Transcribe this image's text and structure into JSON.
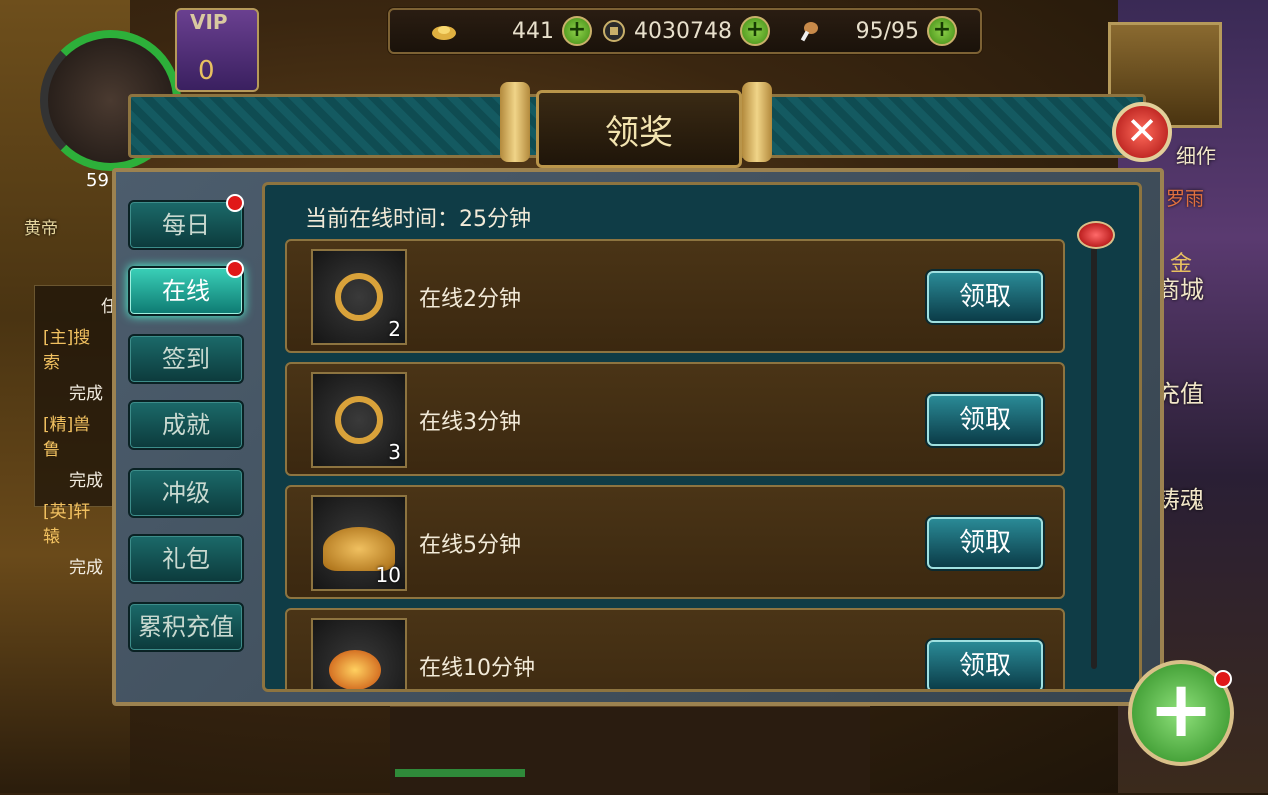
{
  "hud": {
    "vip_label": "VIP",
    "vip_level": "0",
    "player_level": "59",
    "resources": [
      {
        "icon": "gold-ingot-icon",
        "value": "441"
      },
      {
        "icon": "copper-coin-icon",
        "value": "4030748"
      },
      {
        "icon": "drumstick-icon",
        "value": "95/95"
      }
    ],
    "add_symbol": "+"
  },
  "side": {
    "left_name": "黄帝",
    "right_top": "细作",
    "right_name": "罗雨",
    "shop_gold": "金",
    "shop": "商城",
    "recharge": "充值",
    "forge": "铸魂"
  },
  "quests": [
    {
      "tag": "[主]搜索",
      "status": "完成"
    },
    {
      "tag": "[精]兽鲁",
      "status": "完成"
    },
    {
      "tag": "[英]轩辕",
      "status": "完成"
    }
  ],
  "quest_title": "任",
  "dialog": {
    "title": "领奖",
    "close_symbol": "✕",
    "online_time": "当前在线时间：25分钟",
    "tabs": [
      {
        "label": "每日",
        "active": false,
        "dot": true
      },
      {
        "label": "在线",
        "active": true,
        "dot": true
      },
      {
        "label": "签到",
        "active": false,
        "dot": false
      },
      {
        "label": "成就",
        "active": false,
        "dot": false
      },
      {
        "label": "冲级",
        "active": false,
        "dot": false
      },
      {
        "label": "礼包",
        "active": false,
        "dot": false
      },
      {
        "label": "累积充值",
        "active": false,
        "dot": false
      }
    ],
    "rewards": [
      {
        "label": "在线2分钟",
        "qty": "2",
        "icon": "coin-item-icon",
        "button": "领取"
      },
      {
        "label": "在线3分钟",
        "qty": "3",
        "icon": "coin-item-icon",
        "button": "领取"
      },
      {
        "label": "在线5分钟",
        "qty": "10",
        "icon": "gold-pile-icon",
        "button": "领取"
      },
      {
        "label": "在线10分钟",
        "qty": "",
        "icon": "fire-ore-icon",
        "button": "领取"
      }
    ]
  },
  "fab_symbol": "+"
}
